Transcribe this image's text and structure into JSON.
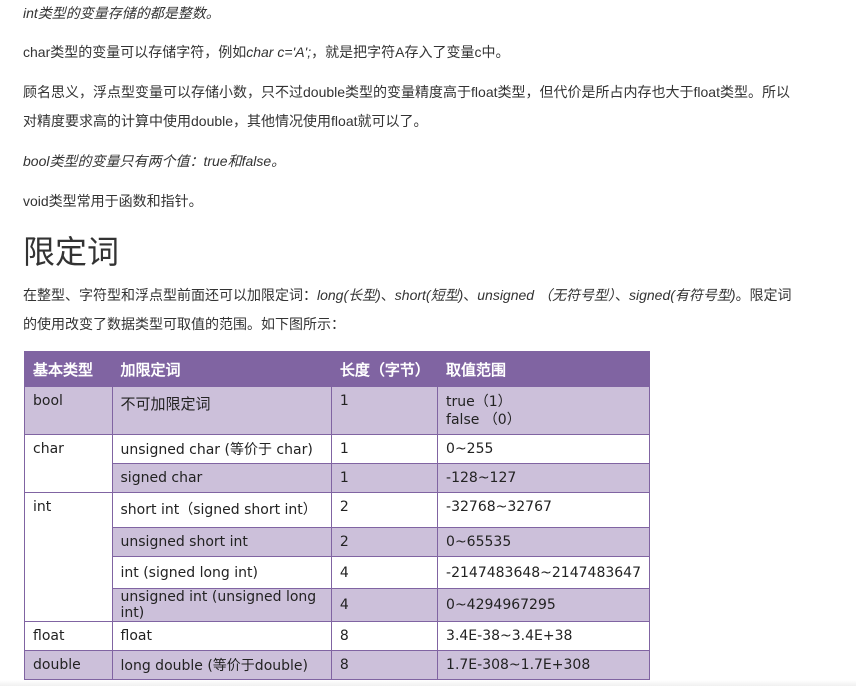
{
  "paragraphs": {
    "p1": "int类型的变量存储的都是整数。",
    "p2_pre": "char类型的变量可以存储字符，例如",
    "p2_em": "char c='A';",
    "p2_post": "，就是把字符A存入了变量c中。",
    "p3": "顾名思义，浮点型变量可以存储小数，只不过double类型的变量精度高于float类型，但代价是所占内存也大于float类型。所以对精度要求高的计算中使用double，其他情况使用float就可以了。",
    "p4": "bool类型的变量只有两个值：true和false。",
    "p5": "void类型常用于函数和指针。"
  },
  "heading": "限定词",
  "intro": {
    "pre": "在整型、字符型和浮点型前面还可以加限定词：",
    "long": "long(长型)",
    "sep1": "、",
    "short": "short(短型)",
    "sep2": "、",
    "unsigned": "unsigned （无符号型）",
    "sep3": "、",
    "signed": "signed(有符号型)",
    "post": "。限定词的使用改变了数据类型可取值的范围。如下图所示："
  },
  "table": {
    "headers": [
      "基本类型",
      "加限定词",
      "长度（字节）",
      "取值范围"
    ],
    "bool": {
      "type": "bool",
      "qualifier": "不可加限定词",
      "length": "1",
      "range1": "true（1）",
      "range2": "false （0）"
    },
    "char": {
      "type": "char",
      "rows": [
        {
          "qualifier": "unsigned char (等价于 char)",
          "length": "1",
          "range": "0~255"
        },
        {
          "qualifier": "signed char",
          "length": "1",
          "range": "-128~127"
        }
      ]
    },
    "int": {
      "type": "int",
      "rows": [
        {
          "qualifier": "short int（signed short int）",
          "length": "2",
          "range": "-32768~32767"
        },
        {
          "qualifier": "unsigned short int",
          "length": "2",
          "range": "0~65535"
        },
        {
          "qualifier": "int (signed long int)",
          "length": "4",
          "range": "-2147483648~2147483647"
        },
        {
          "qualifier": "unsigned int (unsigned long int)",
          "length": "4",
          "range": "0~4294967295"
        }
      ]
    },
    "float": {
      "type": "float",
      "qualifier": "float",
      "length": "8",
      "range": "3.4E-38~3.4E+38"
    },
    "double": {
      "type": "double",
      "qualifier": "long double (等价于double)",
      "length": "8",
      "range": "1.7E-308~1.7E+308"
    }
  },
  "colors": {
    "header_bg": "#8064a2",
    "alt_row_bg": "#ccc0da",
    "border": "#8064a2"
  }
}
